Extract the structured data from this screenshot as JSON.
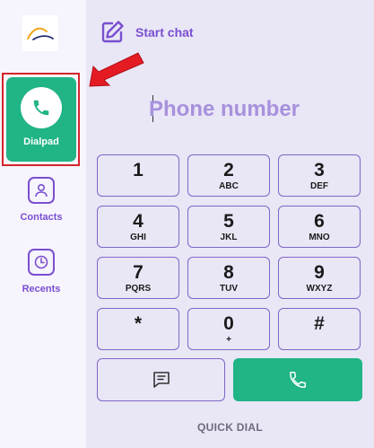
{
  "sidebar": {
    "items": [
      {
        "label": "Dialpad",
        "icon": "phone-icon",
        "active": true
      },
      {
        "label": "Contacts",
        "icon": "contact-icon"
      },
      {
        "label": "Recents",
        "icon": "clock-icon"
      }
    ]
  },
  "header": {
    "start_chat_label": "Start chat"
  },
  "dialer": {
    "placeholder": "Phone number"
  },
  "keypad": [
    {
      "digit": "1",
      "letters": ""
    },
    {
      "digit": "2",
      "letters": "ABC"
    },
    {
      "digit": "3",
      "letters": "DEF"
    },
    {
      "digit": "4",
      "letters": "GHI"
    },
    {
      "digit": "5",
      "letters": "JKL"
    },
    {
      "digit": "6",
      "letters": "MNO"
    },
    {
      "digit": "7",
      "letters": "PQRS"
    },
    {
      "digit": "8",
      "letters": "TUV"
    },
    {
      "digit": "9",
      "letters": "WXYZ"
    },
    {
      "digit": "*",
      "letters": ""
    },
    {
      "digit": "0",
      "letters": "+"
    },
    {
      "digit": "#",
      "letters": ""
    }
  ],
  "footer": {
    "quick_dial_label": "QUICK DIAL"
  },
  "colors": {
    "accent": "#7a4fd0",
    "call_green": "#20b486",
    "highlight_red": "#d3262c"
  }
}
